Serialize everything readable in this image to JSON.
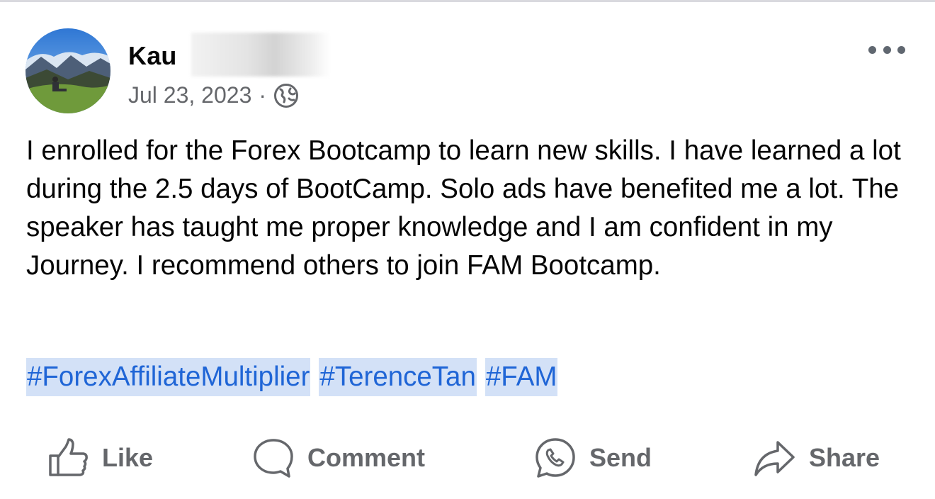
{
  "post": {
    "author": "Kau",
    "date": "Jul 23, 2023",
    "separator": "·",
    "privacy_icon": "globe-icon",
    "more_icon": "more-options-icon",
    "body": "I enrolled for the Forex Bootcamp to learn new skills. I have learned a lot during the 2.5 days of BootCamp. Solo ads have benefited me a lot. The speaker has taught me proper knowledge and I am confident in my Journey. I recommend others to join FAM Bootcamp.",
    "hashtags": [
      "#ForexAffiliateMultiplier",
      "#TerenceTan",
      "#FAM"
    ]
  },
  "actions": {
    "like": {
      "label": "Like",
      "icon": "thumbs-up-icon"
    },
    "comment": {
      "label": "Comment",
      "icon": "comment-bubble-icon"
    },
    "send": {
      "label": "Send",
      "icon": "messenger-icon"
    },
    "share": {
      "label": "Share",
      "icon": "share-arrow-icon"
    }
  },
  "colors": {
    "text": "#050505",
    "muted": "#65676b",
    "hashtag": "#1f65d6",
    "hashtag_highlight": "#d3e1f7"
  }
}
